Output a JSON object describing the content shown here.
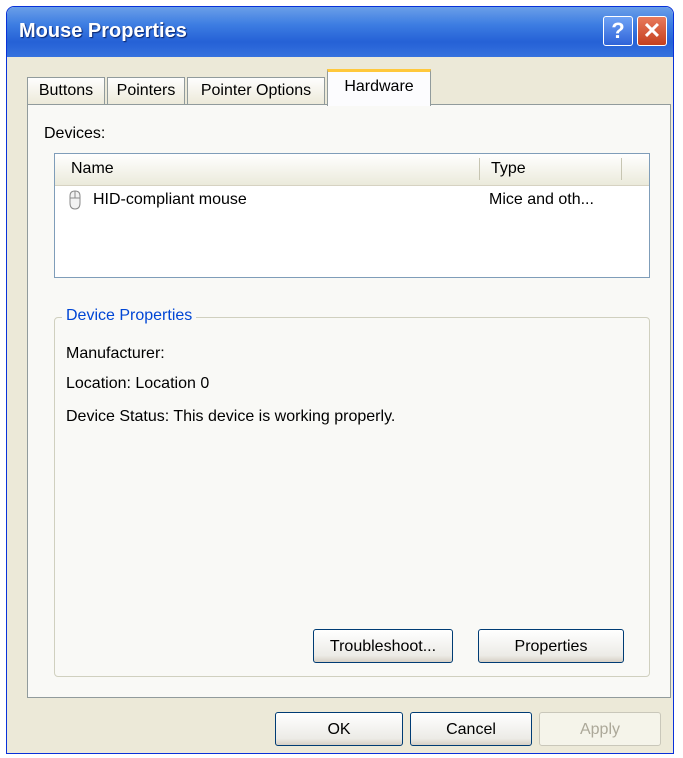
{
  "window": {
    "title": "Mouse Properties",
    "help_symbol": "?",
    "close_symbol": "✕"
  },
  "tabs": [
    {
      "label": "Buttons",
      "active": false
    },
    {
      "label": "Pointers",
      "active": false
    },
    {
      "label": "Pointer Options",
      "active": false
    },
    {
      "label": "Hardware",
      "active": true
    }
  ],
  "devices": {
    "label": "Devices:",
    "columns": {
      "name": "Name",
      "type": "Type"
    },
    "rows": [
      {
        "name": "HID-compliant mouse",
        "type": "Mice and oth...",
        "icon": "mouse-icon"
      }
    ]
  },
  "device_properties": {
    "title": "Device Properties",
    "manufacturer": "Manufacturer:",
    "location": "Location: Location 0",
    "status": "Device Status: This device is working properly."
  },
  "buttons": {
    "troubleshoot": "Troubleshoot...",
    "properties": "Properties",
    "ok": "OK",
    "cancel": "Cancel",
    "apply": "Apply"
  },
  "colors": {
    "titlebar": "#2561d6",
    "dialog_bg": "#ece9d8",
    "group_title": "#0046d5",
    "active_tab_accent": "#ffc83c"
  }
}
